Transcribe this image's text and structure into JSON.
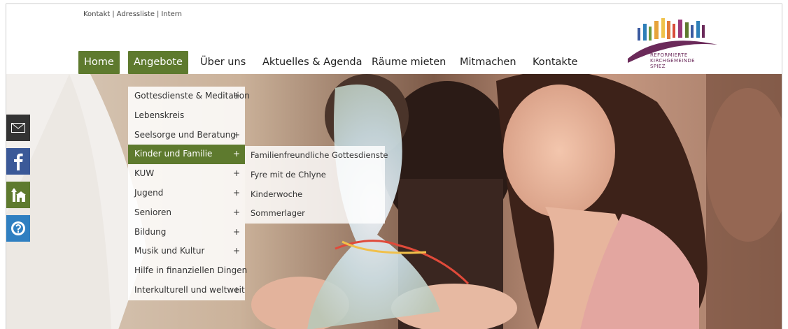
{
  "util_links": [
    "Kontakt",
    "Adressliste",
    "Intern"
  ],
  "util_separator": "|",
  "nav": {
    "items": [
      "Home",
      "Angebote",
      "Über uns",
      "Aktuelles & Agenda",
      "Räume mieten",
      "Mitmachen",
      "Kontakte"
    ],
    "active": [
      "Home",
      "Angebote"
    ]
  },
  "logo": {
    "text": "REFORMIERTE\nKIRCHGEMEINDE\nSPIEZ"
  },
  "social_icons": [
    "mail-icon",
    "facebook-icon",
    "church-icon",
    "help-icon"
  ],
  "social_colors": [
    "#333333",
    "#3b5998",
    "#5e7a2e",
    "#2f7fc1"
  ],
  "dropdown": {
    "items": [
      {
        "label": "Gottesdienste & Meditation",
        "plus": "+"
      },
      {
        "label": "Lebenskreis",
        "plus": ""
      },
      {
        "label": "Seelsorge und Beratung",
        "plus": "+"
      },
      {
        "label": "Kinder und Familie",
        "plus": "+"
      },
      {
        "label": "KUW",
        "plus": "+"
      },
      {
        "label": "Jugend",
        "plus": "+"
      },
      {
        "label": "Senioren",
        "plus": "+"
      },
      {
        "label": "Bildung",
        "plus": "+"
      },
      {
        "label": "Musik und Kultur",
        "plus": "+"
      },
      {
        "label": "Hilfe in finanziellen Dingen",
        "plus": ""
      },
      {
        "label": "Interkulturell und weltweit",
        "plus": "+"
      }
    ],
    "active_label": "Kinder und Familie"
  },
  "subdropdown": {
    "items": [
      "Familienfreundliche Gottesdienste",
      "Fyre mit de Chlyne",
      "Kinderwoche",
      "Sommerlager"
    ]
  },
  "colors": {
    "accent_green": "#5e7a2e",
    "logo_purple": "#6b2a5a"
  }
}
